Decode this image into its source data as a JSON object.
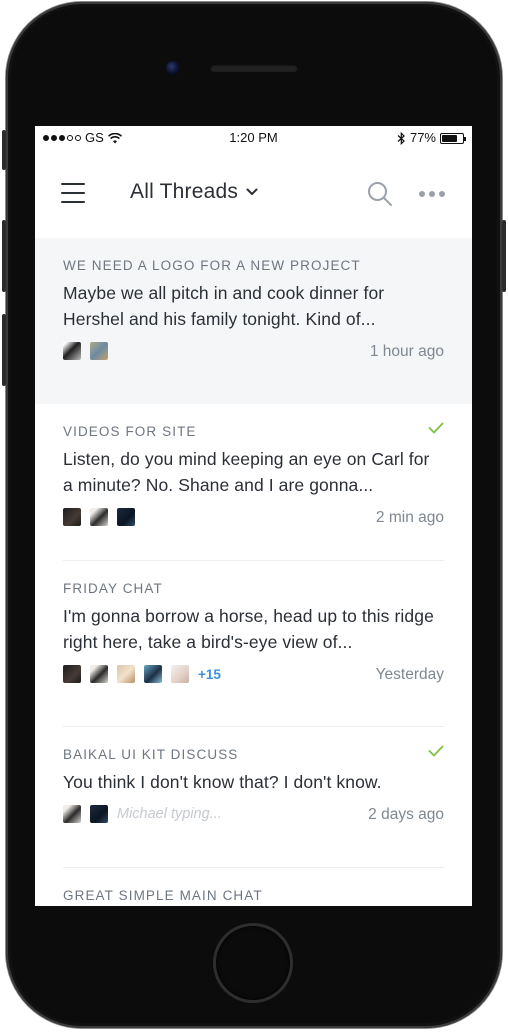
{
  "status_bar": {
    "carrier": "GS",
    "time": "1:20 PM",
    "battery": "77%",
    "battery_level": 0.77
  },
  "nav": {
    "title": "All Threads",
    "icons": [
      "menu-icon",
      "chevron-down-icon",
      "search-icon",
      "more-icon"
    ]
  },
  "threads": [
    {
      "title": "WE NEED A LOGO FOR A NEW PROJECT",
      "body": "Maybe we all pitch in and cook dinner for Hershel and his family tonight. Kind of...",
      "time": "1 hour ago",
      "checked": false,
      "active": true
    },
    {
      "title": "VIDEOS FOR SITE",
      "body": "Listen, do you mind keeping an eye on Carl for a minute? No. Shane and I are gonna...",
      "time": "2 min ago",
      "checked": true,
      "active": false
    },
    {
      "title": "FRIDAY CHAT",
      "body": "I'm gonna borrow a horse, head up to this ridge right here, take a bird's-eye view of...",
      "time": "Yesterday",
      "more": "+15",
      "checked": false,
      "active": false
    },
    {
      "title": "BAIKAL UI KIT DISCUSS",
      "body": "You think I don't know that? I don't know.",
      "time": "2 days ago",
      "typing": "Michael typing...",
      "checked": true,
      "active": false
    },
    {
      "title": "GREAT SIMPLE MAIN CHAT"
    }
  ],
  "colors": {
    "accent": "#3f8fe0",
    "check": "#7cc242",
    "text": "#2b2f36",
    "muted": "#7f8791",
    "active_bg": "#f5f6f7"
  }
}
